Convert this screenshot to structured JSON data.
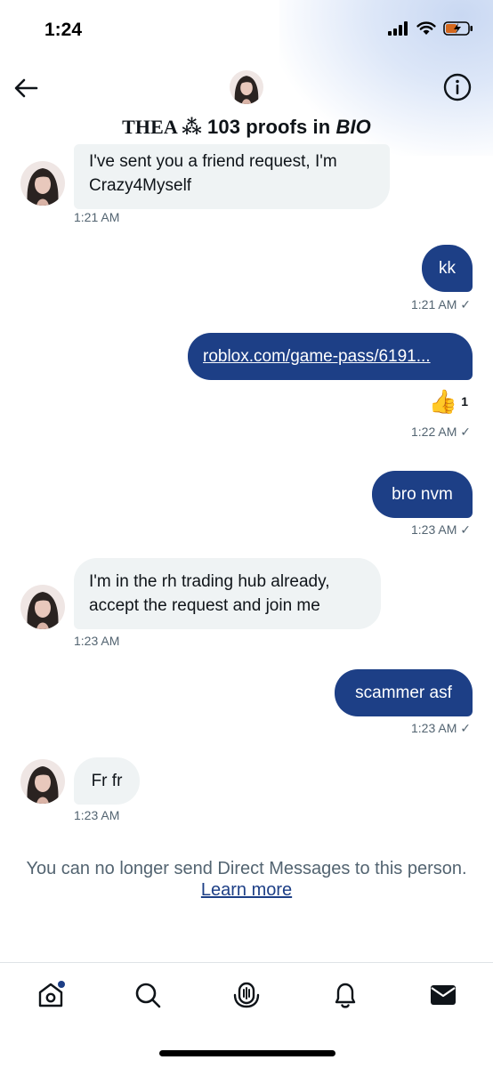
{
  "status_bar": {
    "time": "1:24"
  },
  "header": {
    "title_part1": "THEA ⁂",
    "title_part2": " 103 proofs in ",
    "title_part3": "BIO"
  },
  "messages": [
    {
      "side": "in",
      "text_line1": "I've sent you a friend request, I'm",
      "text_line2": "Crazy4Myself",
      "time": "1:21 AM"
    },
    {
      "side": "out",
      "text": "kk",
      "time": "1:21 AM ✓"
    },
    {
      "side": "out",
      "text": "roblox.com/game-pass/6191...",
      "reaction_emoji": "👍",
      "reaction_count": "1",
      "time": "1:22 AM ✓"
    },
    {
      "side": "out",
      "text": "bro nvm",
      "time": "1:23 AM ✓"
    },
    {
      "side": "in",
      "text_line1": "I'm in the rh trading hub already,",
      "text_line2": "accept the request and join me",
      "time": "1:23 AM"
    },
    {
      "side": "out",
      "text": "scammer asf",
      "time": "1:23 AM ✓"
    },
    {
      "side": "in",
      "text": "Fr fr",
      "time": "1:23 AM"
    }
  ],
  "notice": {
    "text": "You can no longer send Direct Messages to this person.",
    "link": "Learn more"
  },
  "colors": {
    "accent": "#1d3f86",
    "incoming_bubble": "#eff3f4",
    "muted_text": "#536471"
  },
  "tabs": [
    {
      "name": "home",
      "icon": "home-icon"
    },
    {
      "name": "search",
      "icon": "search-icon"
    },
    {
      "name": "spaces",
      "icon": "spaces-icon"
    },
    {
      "name": "notifications",
      "icon": "bell-icon"
    },
    {
      "name": "messages",
      "icon": "mail-icon"
    }
  ]
}
